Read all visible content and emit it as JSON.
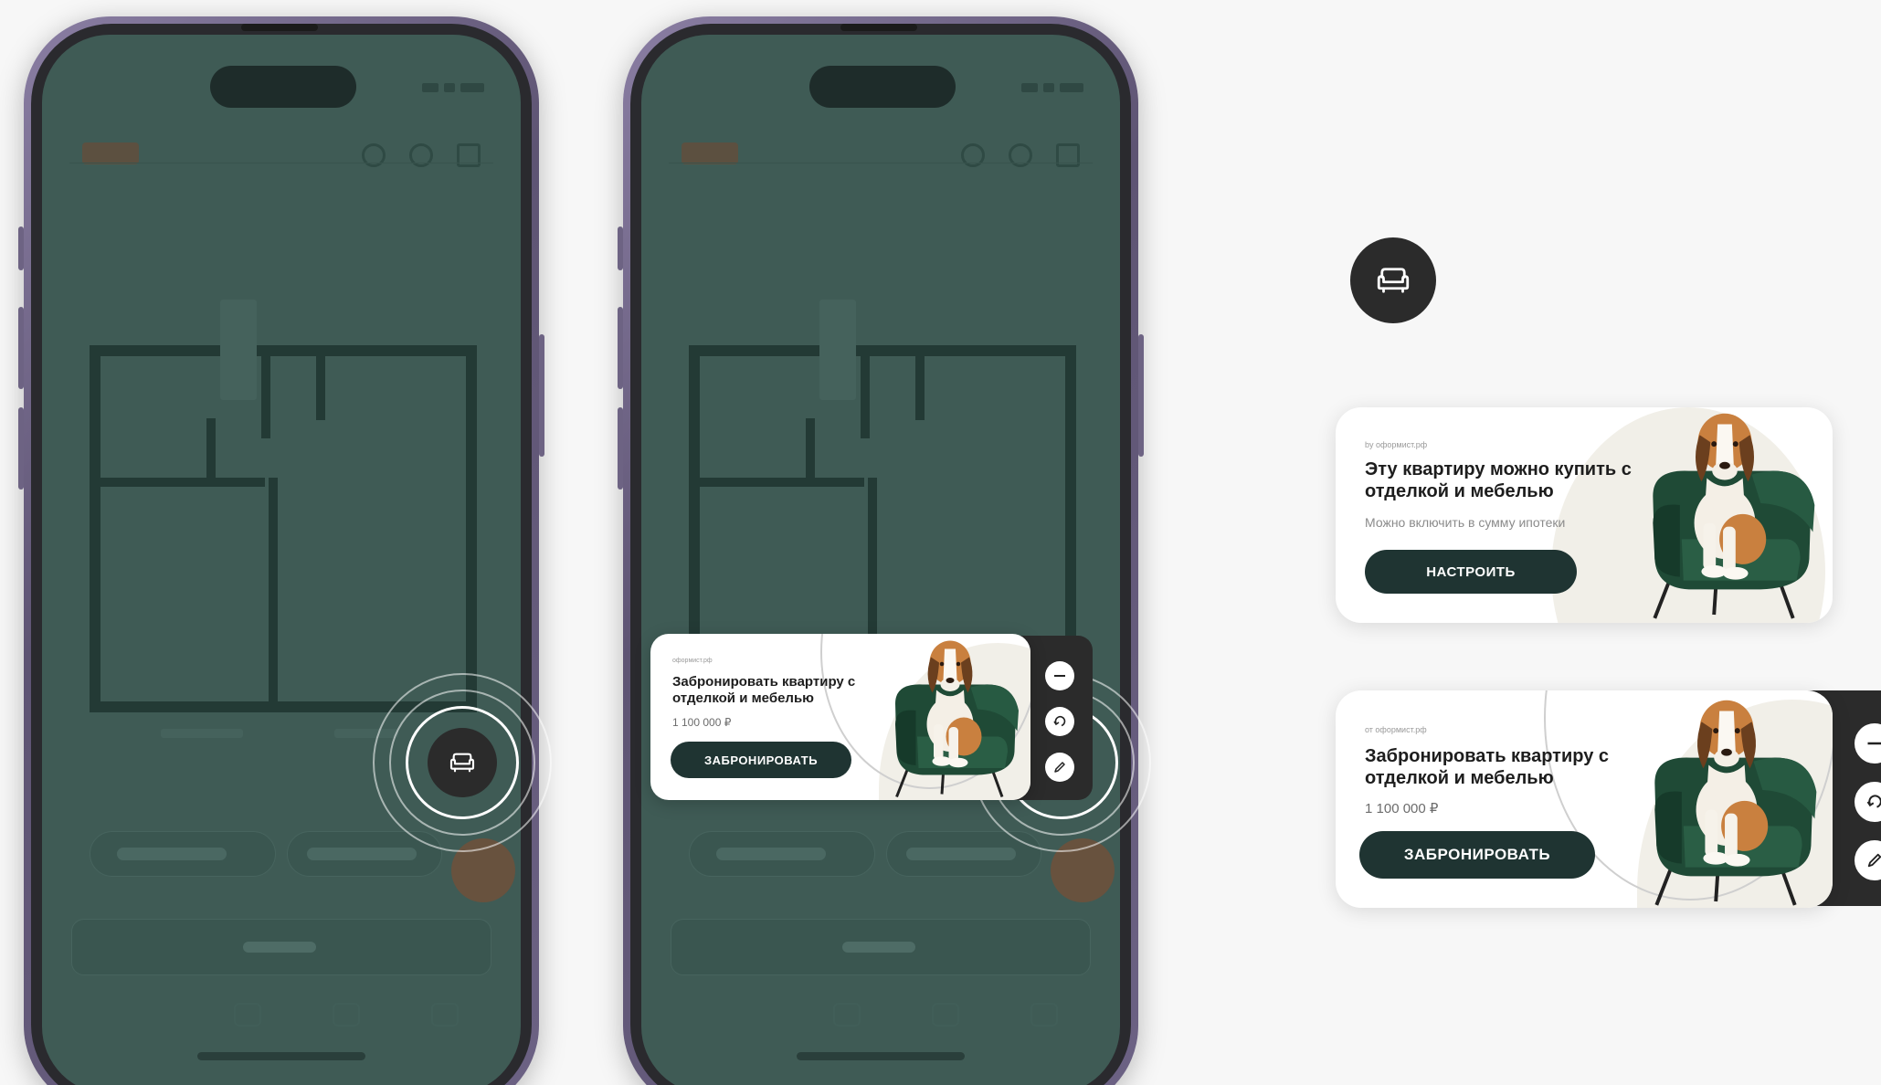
{
  "phone_left": {
    "fab": {
      "icon": "armchair-icon"
    }
  },
  "phone_middle": {
    "popup": {
      "source": "оформист.рф",
      "title": "Забронировать квартиру с отделкой и мебелью",
      "price": "1 100 000 ₽",
      "button_label": "ЗАБРОНИРОВАТЬ",
      "controls": [
        "minimize-icon",
        "rotate-icon",
        "pencil-icon"
      ]
    }
  },
  "standalone": {
    "fab": {
      "icon": "armchair-icon"
    },
    "card_configure": {
      "source": "by оформист.рф",
      "title": "Эту квартиру можно купить с отделкой и мебелью",
      "subtitle": "Можно включить в сумму ипотеки",
      "button_label": "НАСТРОИТЬ"
    },
    "card_book": {
      "source": "от оформист.рф",
      "title": "Забронировать квартиру с отделкой и мебелью",
      "price": "1 100 000 ₽",
      "button_label": "ЗАБРОНИРОВАТЬ",
      "controls": [
        "minimize-icon",
        "rotate-icon",
        "pencil-icon"
      ]
    }
  },
  "colors": {
    "background": "#f7f7f7",
    "screen_overlay": "#3f5b55",
    "button_dark": "#1f3432",
    "fab_dark": "#2b2b2b",
    "chair_green": "#1f4a36"
  }
}
